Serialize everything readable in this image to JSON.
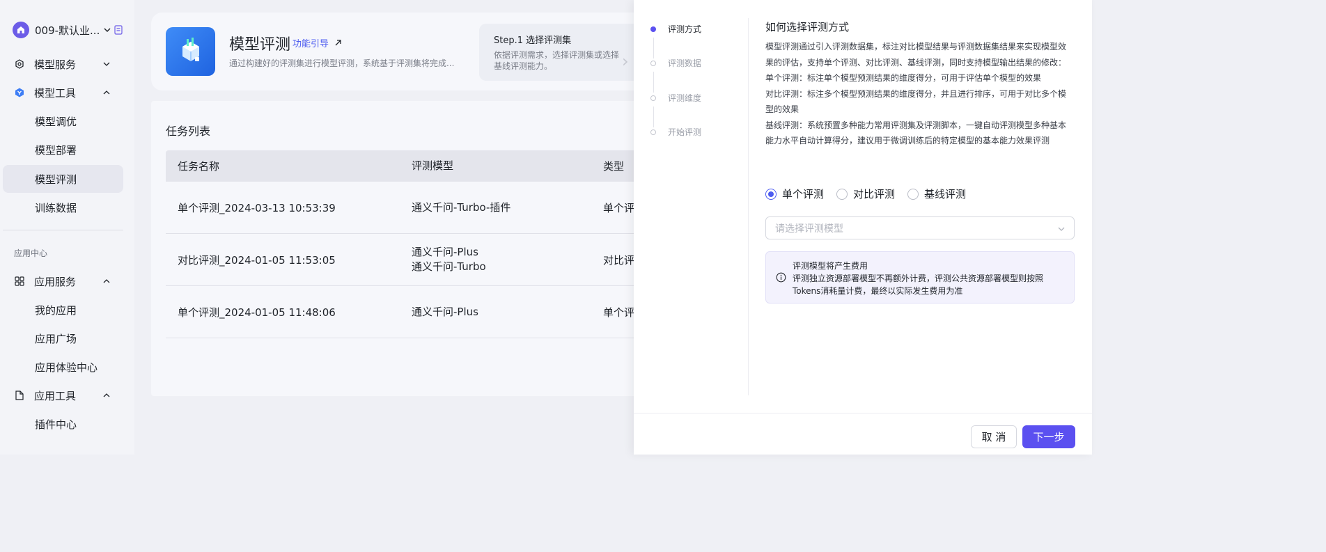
{
  "sidebar": {
    "workspace_name": "009-默认业...",
    "nav": [
      {
        "label": "模型服务",
        "icon": "model-service-icon"
      },
      {
        "label": "模型工具",
        "icon": "model-tools-icon"
      },
      {
        "label": "模型调优"
      },
      {
        "label": "模型部署"
      },
      {
        "label": "模型评测",
        "active": true
      },
      {
        "label": "训练数据"
      }
    ],
    "section_label": "应用中心",
    "nav2": [
      {
        "label": "应用服务",
        "icon": "grid-icon"
      },
      {
        "label": "我的应用"
      },
      {
        "label": "应用广场"
      },
      {
        "label": "应用体验中心"
      },
      {
        "label": "应用工具",
        "icon": "app-tools-icon"
      },
      {
        "label": "插件中心"
      }
    ]
  },
  "header": {
    "title": "模型评测",
    "guide_link": "功能引导",
    "description": "通过构建好的评测集进行模型评测，系统基于评测集将完成...",
    "step_title": "Step.1 选择评测集",
    "step_desc": "依据评测需求，选择评测集或选择基线评测能力。"
  },
  "task_list": {
    "title": "任务列表",
    "columns": [
      "任务名称",
      "评测模型",
      "类型"
    ],
    "rows": [
      {
        "name": "单个评测_2024-03-13 10:53:39",
        "model_1": "通义千问-Turbo-插件",
        "model_2": "",
        "type": "单个评"
      },
      {
        "name": "对比评测_2024-01-05 11:53:05",
        "model_1": "通义千问-Plus",
        "model_2": "通义千问-Turbo",
        "type": "对比评"
      },
      {
        "name": "单个评测_2024-01-05 11:48:06",
        "model_1": "通义千问-Plus",
        "model_2": "",
        "type": "单个评"
      }
    ]
  },
  "drawer": {
    "steps": [
      "评测方式",
      "评测数据",
      "评测维度",
      "开始评测"
    ],
    "active_step": 0,
    "info_title": "如何选择评测方式",
    "info_lines": [
      "模型评测通过引入评测数据集，标注对比模型结果与评测数据集结果来实现模型效果的评估，支持单个评测、对比评测、基线评测，同时支持模型输出结果的修改：",
      "单个评测：标注单个模型预测结果的维度得分，可用于评估单个模型的效果",
      "对比评测：标注多个模型预测结果的维度得分，并且进行排序，可用于对比多个模型的效果",
      "基线评测：系统预置多种能力常用评测集及评测脚本，一键自动评测模型多种基本能力水平自动计算得分，建议用于微调训练后的特定模型的基本能力效果评测"
    ],
    "radio_options": [
      "单个评测",
      "对比评测",
      "基线评测"
    ],
    "radio_selected": 0,
    "select_placeholder": "请选择评测模型",
    "notice_title": "评测模型将产生费用",
    "notice_body": "评测独立资源部署模型不再额外计费，评测公共资源部署模型则按照Tokens消耗量计费，最终以实际发生费用为准",
    "cancel_label": "取 消",
    "next_label": "下一步"
  },
  "colors": {
    "accent": "#5b50f0",
    "link": "#4d5cf0"
  }
}
